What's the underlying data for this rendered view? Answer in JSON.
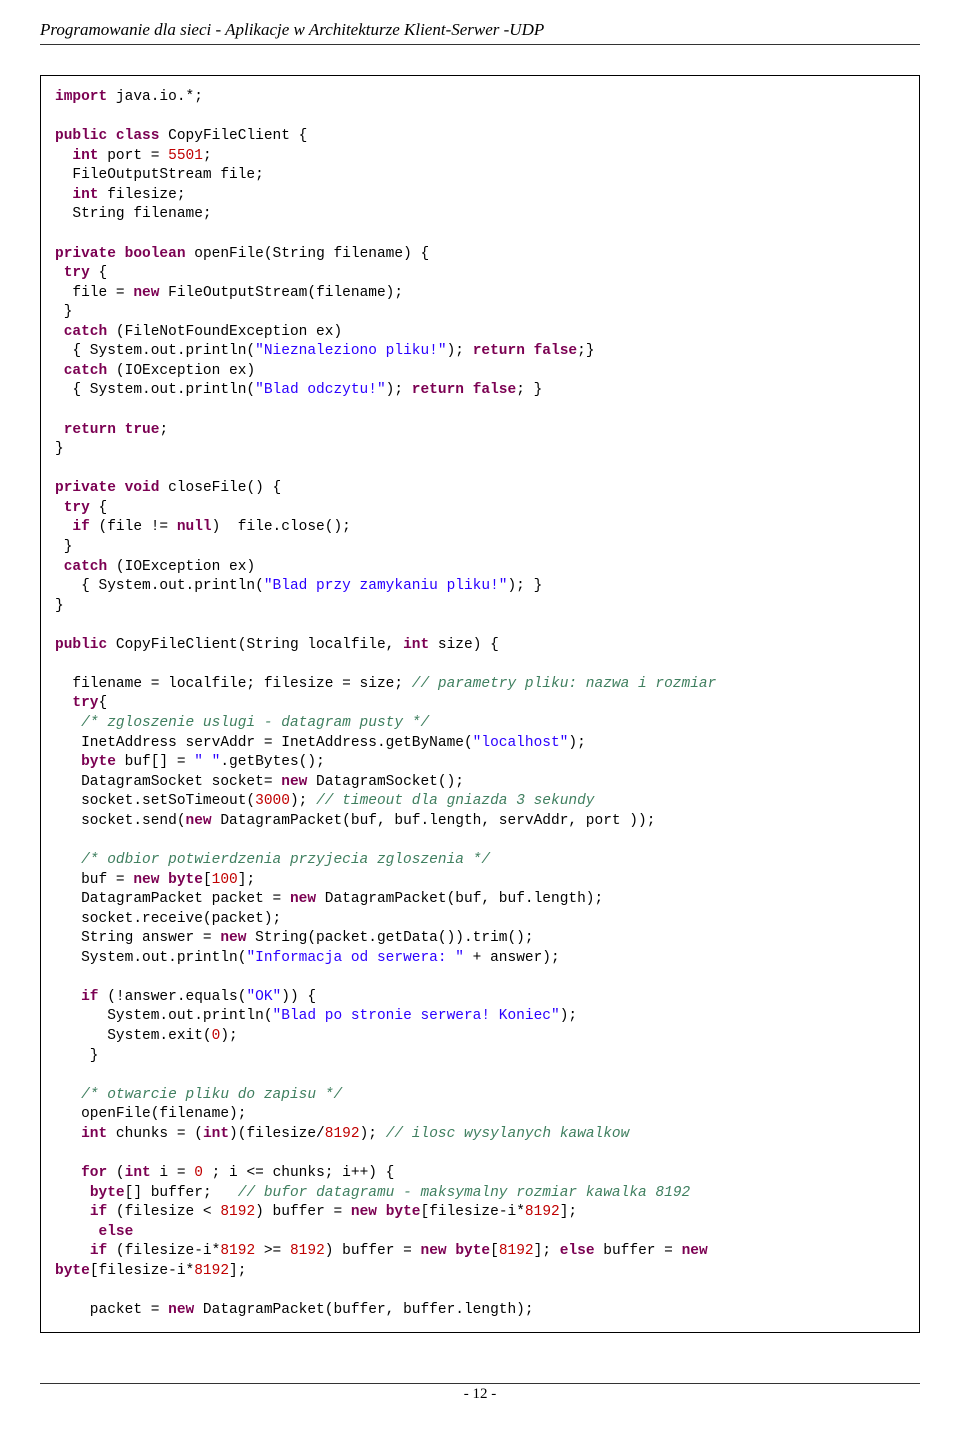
{
  "header": {
    "title": "Programowanie dla sieci - Aplikacje w Architekturze Klient-Serwer -UDP"
  },
  "code": {
    "tokens": [
      {
        "t": "kw",
        "v": "import"
      },
      {
        "t": "",
        "v": " java.io.*;\n\n"
      },
      {
        "t": "kw",
        "v": "public"
      },
      {
        "t": "",
        "v": " "
      },
      {
        "t": "kw",
        "v": "class"
      },
      {
        "t": "",
        "v": " CopyFileClient {\n  "
      },
      {
        "t": "kw",
        "v": "int"
      },
      {
        "t": "",
        "v": " port = "
      },
      {
        "t": "num",
        "v": "5501"
      },
      {
        "t": "",
        "v": ";\n  FileOutputStream file;\n  "
      },
      {
        "t": "kw",
        "v": "int"
      },
      {
        "t": "",
        "v": " filesize;\n  String filename;\n\n"
      },
      {
        "t": "kw",
        "v": "private"
      },
      {
        "t": "",
        "v": " "
      },
      {
        "t": "kw",
        "v": "boolean"
      },
      {
        "t": "",
        "v": " openFile(String filename) {\n "
      },
      {
        "t": "kw",
        "v": "try"
      },
      {
        "t": "",
        "v": " {\n  file = "
      },
      {
        "t": "kw",
        "v": "new"
      },
      {
        "t": "",
        "v": " FileOutputStream(filename);\n }\n "
      },
      {
        "t": "kw",
        "v": "catch"
      },
      {
        "t": "",
        "v": " (FileNotFoundException ex)\n  { System.out.println("
      },
      {
        "t": "str",
        "v": "\"Nieznaleziono pliku!\""
      },
      {
        "t": "",
        "v": "); "
      },
      {
        "t": "kw",
        "v": "return"
      },
      {
        "t": "",
        "v": " "
      },
      {
        "t": "kw",
        "v": "false"
      },
      {
        "t": "",
        "v": ";}\n "
      },
      {
        "t": "kw",
        "v": "catch"
      },
      {
        "t": "",
        "v": " (IOException ex)\n  { System.out.println("
      },
      {
        "t": "str",
        "v": "\"Blad odczytu!\""
      },
      {
        "t": "",
        "v": "); "
      },
      {
        "t": "kw",
        "v": "return"
      },
      {
        "t": "",
        "v": " "
      },
      {
        "t": "kw",
        "v": "false"
      },
      {
        "t": "",
        "v": "; }\n\n "
      },
      {
        "t": "kw",
        "v": "return"
      },
      {
        "t": "",
        "v": " "
      },
      {
        "t": "kw",
        "v": "true"
      },
      {
        "t": "",
        "v": ";\n}\n\n"
      },
      {
        "t": "kw",
        "v": "private"
      },
      {
        "t": "",
        "v": " "
      },
      {
        "t": "kw",
        "v": "void"
      },
      {
        "t": "",
        "v": " closeFile() {\n "
      },
      {
        "t": "kw",
        "v": "try"
      },
      {
        "t": "",
        "v": " {\n  "
      },
      {
        "t": "kw",
        "v": "if"
      },
      {
        "t": "",
        "v": " (file != "
      },
      {
        "t": "kw",
        "v": "null"
      },
      {
        "t": "",
        "v": ")  file.close();\n }\n "
      },
      {
        "t": "kw",
        "v": "catch"
      },
      {
        "t": "",
        "v": " (IOException ex)\n   { System.out.println("
      },
      {
        "t": "str",
        "v": "\"Blad przy zamykaniu pliku!\""
      },
      {
        "t": "",
        "v": "); }\n}\n\n"
      },
      {
        "t": "kw",
        "v": "public"
      },
      {
        "t": "",
        "v": " CopyFileClient(String localfile, "
      },
      {
        "t": "kw",
        "v": "int"
      },
      {
        "t": "",
        "v": " size) {\n\n  filename = localfile; filesize = size; "
      },
      {
        "t": "cmt",
        "v": "// parametry pliku: nazwa i rozmiar"
      },
      {
        "t": "",
        "v": "\n  "
      },
      {
        "t": "kw",
        "v": "try"
      },
      {
        "t": "",
        "v": "{\n   "
      },
      {
        "t": "cmt",
        "v": "/* zgloszenie uslugi - datagram pusty */"
      },
      {
        "t": "",
        "v": "\n   InetAddress servAddr = InetAddress.getByName("
      },
      {
        "t": "str",
        "v": "\"localhost\""
      },
      {
        "t": "",
        "v": ");\n   "
      },
      {
        "t": "kw",
        "v": "byte"
      },
      {
        "t": "",
        "v": " buf[] = "
      },
      {
        "t": "str",
        "v": "\" \""
      },
      {
        "t": "",
        "v": ".getBytes();\n   DatagramSocket socket= "
      },
      {
        "t": "kw",
        "v": "new"
      },
      {
        "t": "",
        "v": " DatagramSocket();\n   socket.setSoTimeout("
      },
      {
        "t": "num",
        "v": "3000"
      },
      {
        "t": "",
        "v": "); "
      },
      {
        "t": "cmt",
        "v": "// timeout dla gniazda 3 sekundy"
      },
      {
        "t": "",
        "v": "\n   socket.send("
      },
      {
        "t": "kw",
        "v": "new"
      },
      {
        "t": "",
        "v": " DatagramPacket(buf, buf.length, servAddr, port ));\n\n   "
      },
      {
        "t": "cmt",
        "v": "/* odbior potwierdzenia przyjecia zgloszenia */"
      },
      {
        "t": "",
        "v": "\n   buf = "
      },
      {
        "t": "kw",
        "v": "new"
      },
      {
        "t": "",
        "v": " "
      },
      {
        "t": "kw",
        "v": "byte"
      },
      {
        "t": "",
        "v": "["
      },
      {
        "t": "num",
        "v": "100"
      },
      {
        "t": "",
        "v": "];\n   DatagramPacket packet = "
      },
      {
        "t": "kw",
        "v": "new"
      },
      {
        "t": "",
        "v": " DatagramPacket(buf, buf.length);\n   socket.receive(packet);\n   String answer = "
      },
      {
        "t": "kw",
        "v": "new"
      },
      {
        "t": "",
        "v": " String(packet.getData()).trim();\n   System.out.println("
      },
      {
        "t": "str",
        "v": "\"Informacja od serwera: \""
      },
      {
        "t": "",
        "v": " + answer);\n\n   "
      },
      {
        "t": "kw",
        "v": "if"
      },
      {
        "t": "",
        "v": " (!answer.equals("
      },
      {
        "t": "str",
        "v": "\"OK\""
      },
      {
        "t": "",
        "v": ")) {\n      System.out.println("
      },
      {
        "t": "str",
        "v": "\"Blad po stronie serwera! Koniec\""
      },
      {
        "t": "",
        "v": ");\n      System.exit("
      },
      {
        "t": "num",
        "v": "0"
      },
      {
        "t": "",
        "v": ");\n    }\n\n   "
      },
      {
        "t": "cmt",
        "v": "/* otwarcie pliku do zapisu */"
      },
      {
        "t": "",
        "v": "\n   openFile(filename);\n   "
      },
      {
        "t": "kw",
        "v": "int"
      },
      {
        "t": "",
        "v": " chunks = ("
      },
      {
        "t": "kw",
        "v": "int"
      },
      {
        "t": "",
        "v": ")(filesize/"
      },
      {
        "t": "num",
        "v": "8192"
      },
      {
        "t": "",
        "v": "); "
      },
      {
        "t": "cmt",
        "v": "// ilosc wysylanych kawalkow"
      },
      {
        "t": "",
        "v": "\n\n   "
      },
      {
        "t": "kw",
        "v": "for"
      },
      {
        "t": "",
        "v": " ("
      },
      {
        "t": "kw",
        "v": "int"
      },
      {
        "t": "",
        "v": " i = "
      },
      {
        "t": "num",
        "v": "0"
      },
      {
        "t": "",
        "v": " ; i <= chunks; i++) {\n    "
      },
      {
        "t": "kw",
        "v": "byte"
      },
      {
        "t": "",
        "v": "[] buffer;   "
      },
      {
        "t": "cmt",
        "v": "// bufor datagramu - maksymalny rozmiar kawalka 8192"
      },
      {
        "t": "",
        "v": "\n    "
      },
      {
        "t": "kw",
        "v": "if"
      },
      {
        "t": "",
        "v": " (filesize < "
      },
      {
        "t": "num",
        "v": "8192"
      },
      {
        "t": "",
        "v": ") buffer = "
      },
      {
        "t": "kw",
        "v": "new"
      },
      {
        "t": "",
        "v": " "
      },
      {
        "t": "kw",
        "v": "byte"
      },
      {
        "t": "",
        "v": "[filesize-i*"
      },
      {
        "t": "num",
        "v": "8192"
      },
      {
        "t": "",
        "v": "];\n     "
      },
      {
        "t": "kw",
        "v": "else"
      },
      {
        "t": "",
        "v": "\n    "
      },
      {
        "t": "kw",
        "v": "if"
      },
      {
        "t": "",
        "v": " (filesize-i*"
      },
      {
        "t": "num",
        "v": "8192"
      },
      {
        "t": "",
        "v": " >= "
      },
      {
        "t": "num",
        "v": "8192"
      },
      {
        "t": "",
        "v": ") buffer = "
      },
      {
        "t": "kw",
        "v": "new"
      },
      {
        "t": "",
        "v": " "
      },
      {
        "t": "kw",
        "v": "byte"
      },
      {
        "t": "",
        "v": "["
      },
      {
        "t": "num",
        "v": "8192"
      },
      {
        "t": "",
        "v": "]; "
      },
      {
        "t": "kw",
        "v": "else"
      },
      {
        "t": "",
        "v": " buffer = "
      },
      {
        "t": "kw",
        "v": "new"
      },
      {
        "t": "",
        "v": "\n"
      },
      {
        "t": "kw",
        "v": "byte"
      },
      {
        "t": "",
        "v": "[filesize-i*"
      },
      {
        "t": "num",
        "v": "8192"
      },
      {
        "t": "",
        "v": "];\n\n    packet = "
      },
      {
        "t": "kw",
        "v": "new"
      },
      {
        "t": "",
        "v": " DatagramPacket(buffer, buffer.length);"
      }
    ]
  },
  "footer": {
    "pagenum": "- 12 -"
  }
}
